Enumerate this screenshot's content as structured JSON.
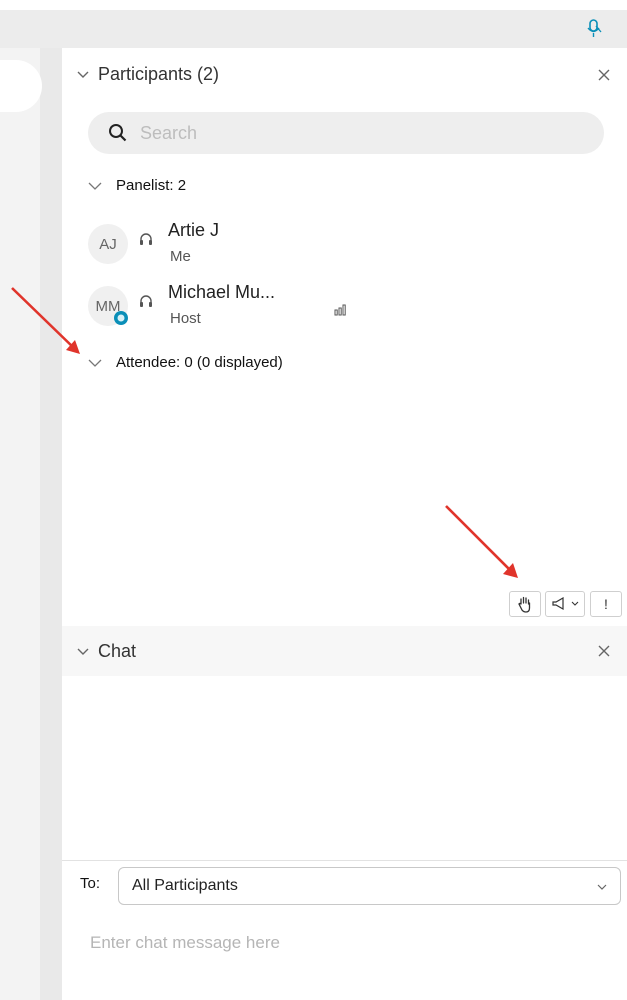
{
  "participants": {
    "title": "Participants (2)",
    "search": {
      "placeholder": "Search",
      "value": ""
    },
    "panelist_section": {
      "label": "Panelist: 2"
    },
    "panelists": [
      {
        "initials": "AJ",
        "name": "Artie J",
        "role": "Me"
      },
      {
        "initials": "MM",
        "name": "Michael Mu...",
        "role": "Host"
      }
    ],
    "attendee_section": {
      "label": "Attendee: 0 (0 displayed)"
    }
  },
  "toolbar": {
    "raise_hand_icon": "raise-hand-icon",
    "megaphone_icon": "megaphone-icon",
    "alert_label": "!"
  },
  "chat": {
    "title": "Chat",
    "to_label": "To:",
    "to_value": "All Participants",
    "input_placeholder": "Enter chat message here"
  },
  "colors": {
    "accent": "#0a8fb8",
    "annotation_arrow": "#e0342b",
    "panel_bg": "#ffffff",
    "strip_bg": "#ececec"
  }
}
